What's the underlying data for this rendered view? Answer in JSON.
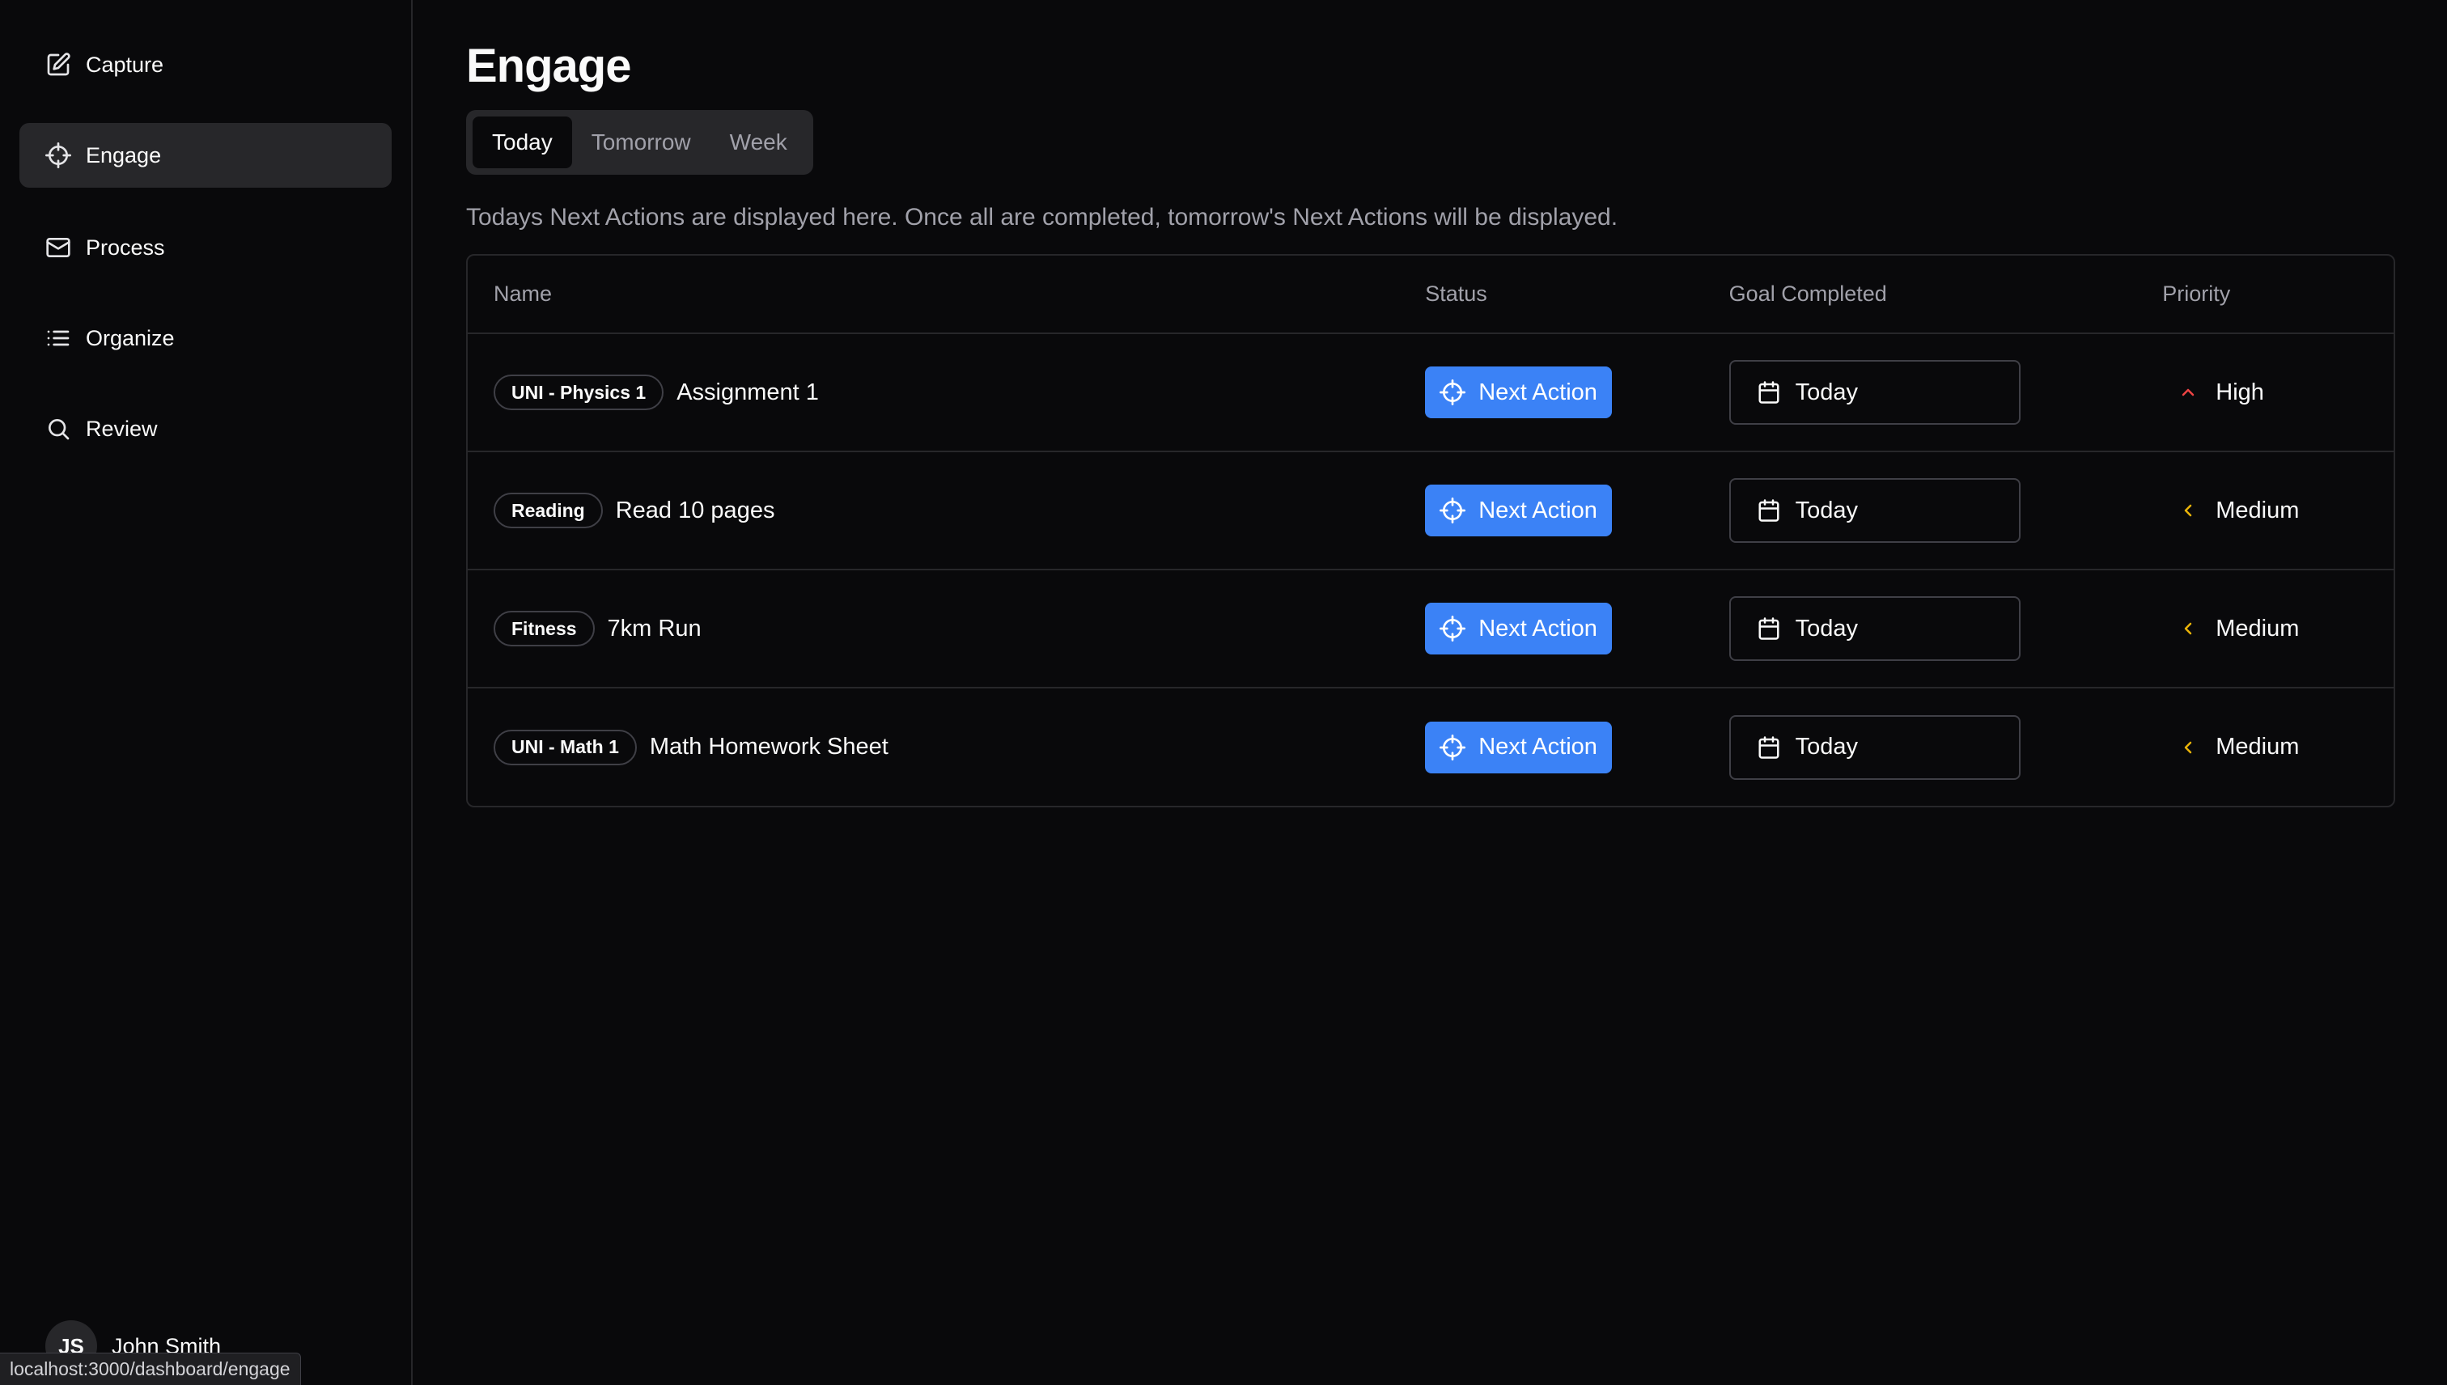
{
  "sidebar": {
    "items": [
      {
        "label": "Capture",
        "icon": "edit-icon",
        "active": false
      },
      {
        "label": "Engage",
        "icon": "crosshair-icon",
        "active": true
      },
      {
        "label": "Process",
        "icon": "mail-icon",
        "active": false
      },
      {
        "label": "Organize",
        "icon": "list-icon",
        "active": false
      },
      {
        "label": "Review",
        "icon": "search-icon",
        "active": false
      }
    ],
    "user": {
      "initials": "JS",
      "name": "John Smith"
    },
    "status_url": "localhost:3000/dashboard/engage"
  },
  "main": {
    "title": "Engage",
    "tabs": [
      {
        "label": "Today",
        "active": true
      },
      {
        "label": "Tomorrow",
        "active": false
      },
      {
        "label": "Week",
        "active": false
      }
    ],
    "description": "Todays Next Actions are displayed here. Once all are completed, tomorrow's Next Actions will be displayed.",
    "table": {
      "headers": {
        "name": "Name",
        "status": "Status",
        "goal": "Goal Completed",
        "priority": "Priority"
      },
      "rows": [
        {
          "tag": "UNI - Physics 1",
          "name": "Assignment 1",
          "status": "Next Action",
          "goal": "Today",
          "priority": "High",
          "priority_icon": "chevron-up-icon",
          "priority_color": "#ef4444"
        },
        {
          "tag": "Reading",
          "name": "Read 10 pages",
          "status": "Next Action",
          "goal": "Today",
          "priority": "Medium",
          "priority_icon": "chevron-left-icon",
          "priority_color": "#eab308"
        },
        {
          "tag": "Fitness",
          "name": "7km Run",
          "status": "Next Action",
          "goal": "Today",
          "priority": "Medium",
          "priority_icon": "chevron-left-icon",
          "priority_color": "#eab308"
        },
        {
          "tag": "UNI - Math 1",
          "name": "Math Homework Sheet",
          "status": "Next Action",
          "goal": "Today",
          "priority": "Medium",
          "priority_icon": "chevron-left-icon",
          "priority_color": "#eab308"
        }
      ]
    }
  },
  "colors": {
    "background": "#09090b",
    "accent": "#3b82f6",
    "border": "#27272a",
    "muted_text": "#a1a1aa"
  }
}
